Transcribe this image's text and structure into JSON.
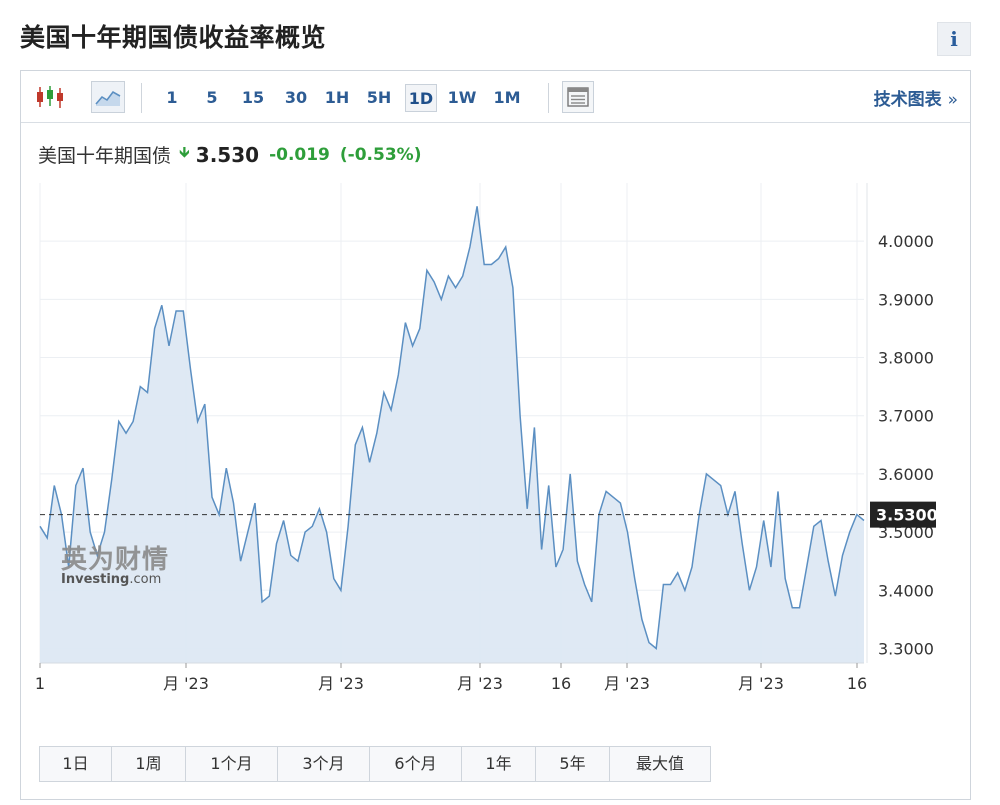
{
  "title": "美国十年期国债收益率概览",
  "info_label": "i",
  "toolbar": {
    "intervals": [
      "1",
      "5",
      "15",
      "30",
      "1H",
      "5H",
      "1D",
      "1W",
      "1M"
    ],
    "active_interval": "1D",
    "tech_link": "技术图表",
    "tech_chevron": "»"
  },
  "legend": {
    "name": "美国十年期国债",
    "price": "3.530",
    "change": "-0.019",
    "change_pct": "(-0.53%)"
  },
  "watermark": {
    "cn": "英为财情",
    "en_bold": "Investing",
    "en_rest": ".com"
  },
  "range_buttons": [
    "1日",
    "1周",
    "1个月",
    "3个月",
    "6个月",
    "1年",
    "5年",
    "最大值"
  ],
  "colors": {
    "line": "#5b8fc2",
    "area": "#dde8f3",
    "down": "#2e9e3a",
    "link": "#2d5c94",
    "last_bg": "#222222"
  },
  "chart_data": {
    "type": "area",
    "y_ticks": [
      "4.0000",
      "3.9000",
      "3.8000",
      "3.7000",
      "3.6000",
      "3.5000",
      "3.4000",
      "3.3000"
    ],
    "x_ticks": [
      "1",
      "月 '23",
      "月 '23",
      "月 '23",
      "16",
      "月 '23",
      "月 '23",
      "16"
    ],
    "ylim": [
      3.275,
      4.1
    ],
    "last_value_label": "3.5300",
    "last_value": 3.53,
    "grid": true,
    "values": [
      3.51,
      3.49,
      3.58,
      3.53,
      3.44,
      3.58,
      3.61,
      3.5,
      3.46,
      3.5,
      3.59,
      3.69,
      3.67,
      3.69,
      3.75,
      3.74,
      3.85,
      3.89,
      3.82,
      3.88,
      3.88,
      3.78,
      3.69,
      3.72,
      3.56,
      3.53,
      3.61,
      3.55,
      3.45,
      3.5,
      3.55,
      3.38,
      3.39,
      3.48,
      3.52,
      3.46,
      3.45,
      3.5,
      3.51,
      3.54,
      3.5,
      3.42,
      3.4,
      3.51,
      3.65,
      3.68,
      3.62,
      3.67,
      3.74,
      3.71,
      3.77,
      3.86,
      3.82,
      3.85,
      3.95,
      3.93,
      3.9,
      3.94,
      3.92,
      3.94,
      3.99,
      4.06,
      3.96,
      3.96,
      3.97,
      3.99,
      3.92,
      3.7,
      3.54,
      3.68,
      3.47,
      3.58,
      3.44,
      3.47,
      3.6,
      3.45,
      3.41,
      3.38,
      3.53,
      3.57,
      3.56,
      3.55,
      3.5,
      3.42,
      3.35,
      3.31,
      3.3,
      3.41,
      3.41,
      3.43,
      3.4,
      3.44,
      3.53,
      3.6,
      3.59,
      3.58,
      3.53,
      3.57,
      3.48,
      3.4,
      3.44,
      3.52,
      3.44,
      3.57,
      3.42,
      3.37,
      3.37,
      3.44,
      3.51,
      3.52,
      3.45,
      3.39,
      3.46,
      3.5,
      3.53,
      3.52
    ]
  }
}
